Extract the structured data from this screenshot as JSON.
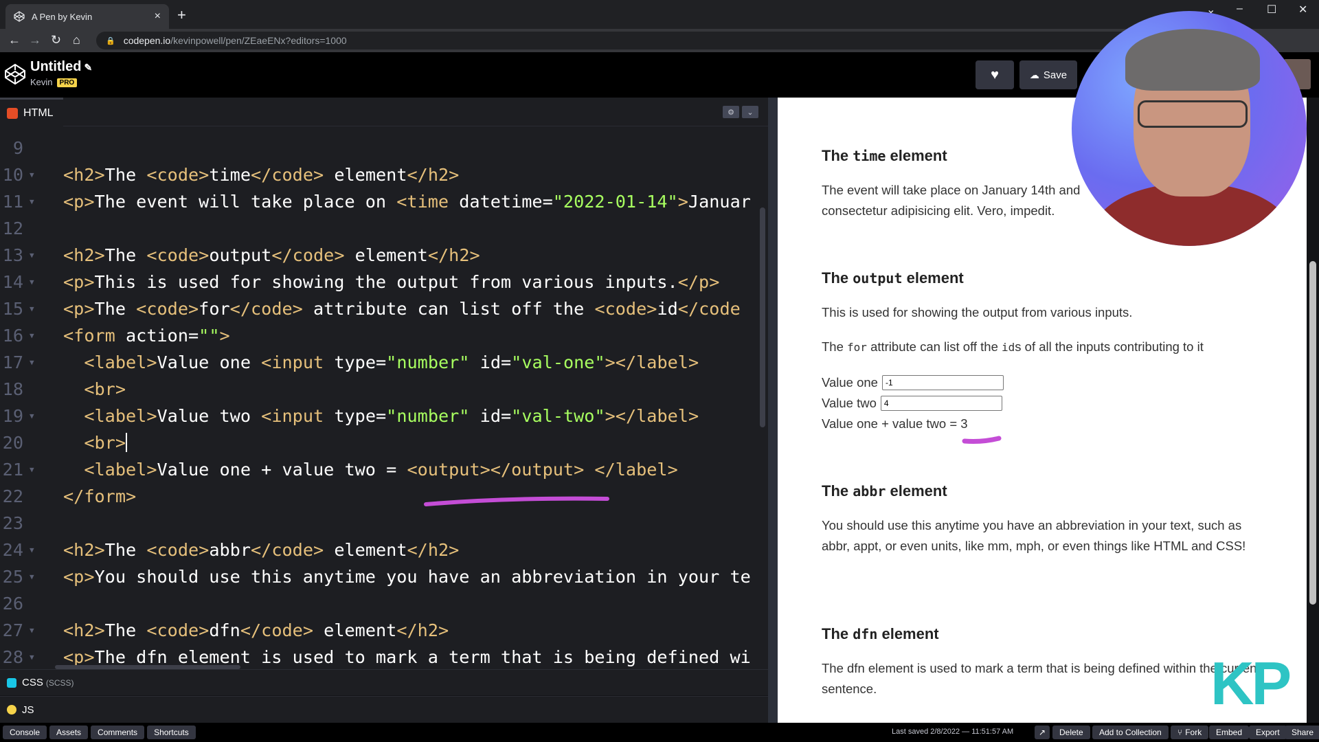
{
  "browser": {
    "tab_title": "A Pen by Kevin",
    "url_host": "codepen.io",
    "url_path": "/kevinpowell/pen/ZEaeENx?editors=1000"
  },
  "header": {
    "title": "Untitled",
    "owner": "Kevin",
    "badge": "PRO",
    "save_label": "Save"
  },
  "editor": {
    "language": "HTML",
    "lines": [
      {
        "n": "9",
        "fold": false,
        "html": ""
      },
      {
        "n": "10",
        "fold": true,
        "html": "<span class='t'>&lt;h2&gt;</span>The <span class='t'>&lt;code&gt;</span>time<span class='t'>&lt;/code&gt;</span> element<span class='t'>&lt;/h2&gt;</span>"
      },
      {
        "n": "11",
        "fold": true,
        "html": "<span class='t'>&lt;p&gt;</span>The event will take place on <span class='t'>&lt;time</span> datetime=<span class='s'>\"2022-01-14\"</span><span class='t'>&gt;</span>Januar"
      },
      {
        "n": "12",
        "fold": false,
        "html": ""
      },
      {
        "n": "13",
        "fold": true,
        "html": "<span class='t'>&lt;h2&gt;</span>The <span class='t'>&lt;code&gt;</span>output<span class='t'>&lt;/code&gt;</span> element<span class='t'>&lt;/h2&gt;</span>"
      },
      {
        "n": "14",
        "fold": true,
        "html": "<span class='t'>&lt;p&gt;</span>This is used for showing the output from various inputs.<span class='t'>&lt;/p&gt;</span>"
      },
      {
        "n": "15",
        "fold": true,
        "html": "<span class='t'>&lt;p&gt;</span>The <span class='t'>&lt;code&gt;</span>for<span class='t'>&lt;/code&gt;</span> attribute can list off the <span class='t'>&lt;code&gt;</span>id<span class='t'>&lt;/code</span>"
      },
      {
        "n": "16",
        "fold": true,
        "html": "<span class='t'>&lt;form</span> action=<span class='s'>\"\"</span><span class='t'>&gt;</span>"
      },
      {
        "n": "17",
        "fold": true,
        "html": "  <span class='t'>&lt;label&gt;</span>Value one <span class='t'>&lt;input</span> type=<span class='s'>\"number\"</span> id=<span class='s'>\"val-one\"</span><span class='t'>&gt;&lt;/label&gt;</span>"
      },
      {
        "n": "18",
        "fold": false,
        "html": "  <span class='t'>&lt;br&gt;</span>"
      },
      {
        "n": "19",
        "fold": true,
        "html": "  <span class='t'>&lt;label&gt;</span>Value two <span class='t'>&lt;input</span> type=<span class='s'>\"number\"</span> id=<span class='s'>\"val-two\"</span><span class='t'>&gt;&lt;/label&gt;</span>"
      },
      {
        "n": "20",
        "fold": false,
        "html": "  <span class='t'>&lt;br&gt;</span><span class='cursor'></span>"
      },
      {
        "n": "21",
        "fold": true,
        "html": "  <span class='t'>&lt;label&gt;</span>Value one + value two = <span class='t'>&lt;output&gt;&lt;/output&gt;</span> <span class='t'>&lt;/label&gt;</span>"
      },
      {
        "n": "22",
        "fold": false,
        "html": "<span class='t'>&lt;/form&gt;</span>"
      },
      {
        "n": "23",
        "fold": false,
        "html": ""
      },
      {
        "n": "24",
        "fold": true,
        "html": "<span class='t'>&lt;h2&gt;</span>The <span class='t'>&lt;code&gt;</span>abbr<span class='t'>&lt;/code&gt;</span> element<span class='t'>&lt;/h2&gt;</span>"
      },
      {
        "n": "25",
        "fold": true,
        "html": "<span class='t'>&lt;p&gt;</span>You should use this anytime you have an abbreviation in your te"
      },
      {
        "n": "26",
        "fold": false,
        "html": ""
      },
      {
        "n": "27",
        "fold": true,
        "html": "<span class='t'>&lt;h2&gt;</span>The <span class='t'>&lt;code&gt;</span>dfn<span class='t'>&lt;/code&gt;</span> element<span class='t'>&lt;/h2&gt;</span>"
      },
      {
        "n": "28",
        "fold": true,
        "html": "<span class='t'>&lt;p&gt;</span>The dfn element is used to mark a term that is being defined wi"
      }
    ],
    "css_label": "CSS",
    "css_sub": "(SCSS)",
    "js_label": "JS"
  },
  "preview": {
    "time_h2_pre": "The ",
    "time_h2_code": "time",
    "time_h2_post": " element",
    "time_p": "The event will take place on January 14th and",
    "time_p2": "consectetur adipisicing elit. Vero, impedit.",
    "output_h2_pre": "The ",
    "output_h2_code": "output",
    "output_h2_post": " element",
    "output_p1": "This is used for showing the output from various inputs.",
    "output_p2_pre": "The ",
    "output_p2_code": "for",
    "output_p2_mid": " attribute can list off the ",
    "output_p2_code2": "id",
    "output_p2_post": "s of all the inputs contributing to it",
    "value_one_label": "Value one",
    "value_one": "-1",
    "value_two_label": "Value two",
    "value_two": "4",
    "sum_label": "Value one + value two = 3",
    "abbr_h2_pre": "The ",
    "abbr_h2_code": "abbr",
    "abbr_h2_post": " element",
    "abbr_p": "You should use this anytime you have an abbreviation in your text, such as abbr, appt, or even units, like mm, mph, or even things like HTML and CSS!",
    "dfn_h2_pre": "The ",
    "dfn_h2_code": "dfn",
    "dfn_h2_post": " element",
    "dfn_p": "The dfn element is used to mark a term that is being defined within the current sentence."
  },
  "watermark": "KP",
  "footer": {
    "left": [
      "Console",
      "Assets",
      "Comments",
      "Shortcuts"
    ],
    "saved": "Last saved 2/8/2022 — 11:51:57 AM",
    "right": [
      "Delete",
      "Add to Collection",
      "Fork",
      "Embed",
      "Export",
      "Share"
    ]
  },
  "colors": {
    "tag": "#e6c07b",
    "string": "#a8ff60",
    "annotation": "#c44dd6"
  }
}
